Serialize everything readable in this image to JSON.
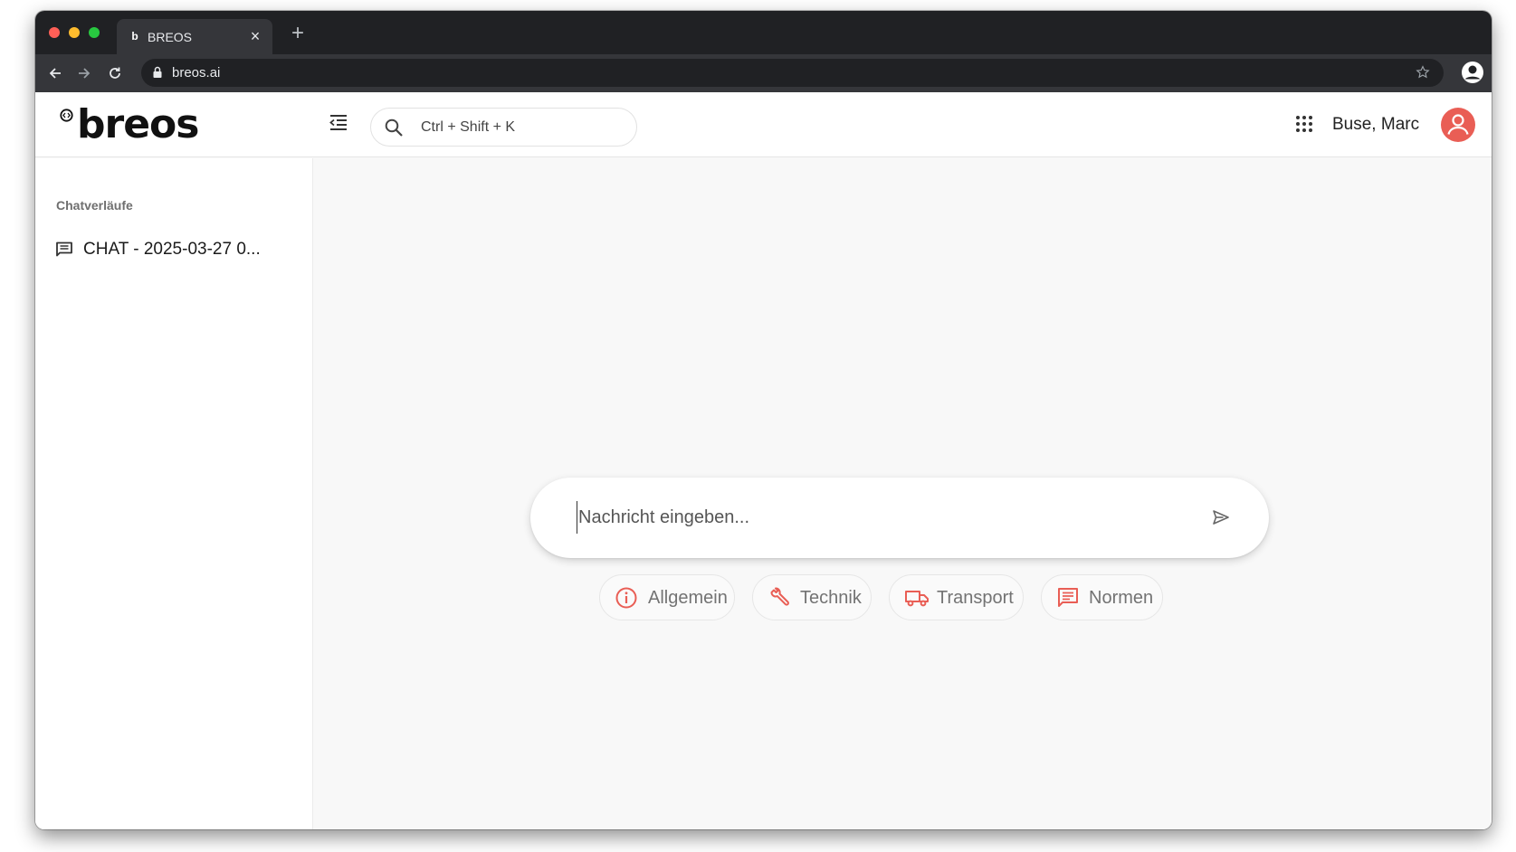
{
  "browser": {
    "tab": {
      "favicon": "b",
      "title": "BREOS",
      "close": "×"
    },
    "new_tab": "+",
    "url": "breos.ai"
  },
  "app": {
    "logo_text": "breos",
    "search": {
      "placeholder": "Ctrl + Shift + K"
    },
    "user": {
      "name": "Buse, Marc"
    },
    "accent_color": "#e95e55"
  },
  "sidebar": {
    "heading": "Chatverläufe",
    "items": [
      {
        "label": "CHAT - 2025-03-27 0...",
        "icon": "chat-icon"
      }
    ]
  },
  "composer": {
    "placeholder": "Nachricht eingeben...",
    "send_icon": "send-icon"
  },
  "categories": [
    {
      "label": "Allgemein",
      "icon": "info-icon"
    },
    {
      "label": "Technik",
      "icon": "wrench-icon"
    },
    {
      "label": "Transport",
      "icon": "truck-icon"
    },
    {
      "label": "Normen",
      "icon": "document-icon"
    }
  ]
}
